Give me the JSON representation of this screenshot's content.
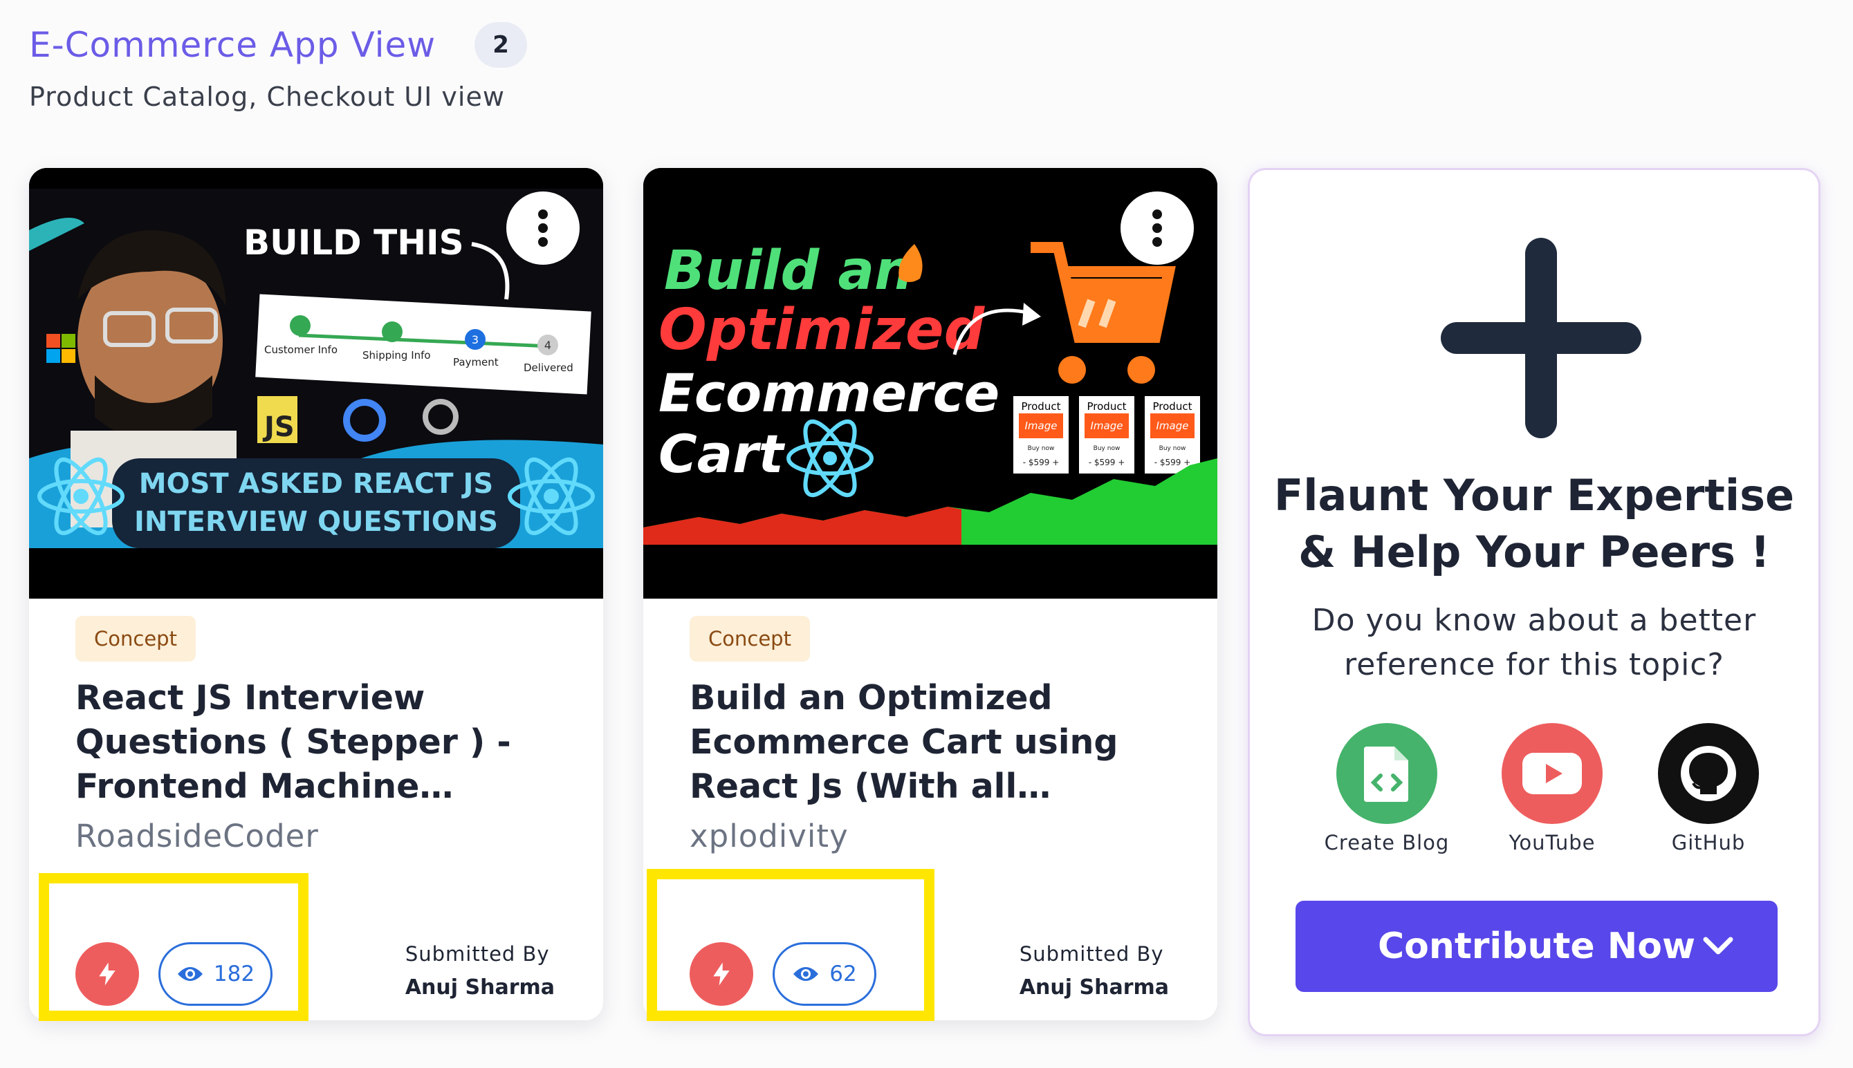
{
  "section": {
    "title": "E-Commerce App View",
    "count": "2",
    "subtitle": "Product Catalog, Checkout UI view"
  },
  "cards": [
    {
      "thumb": {
        "headline": "BUILD THIS",
        "steps": [
          "Customer Info",
          "Shipping Info",
          "Payment",
          "Delivered"
        ],
        "step_numbers": [
          "3",
          "4"
        ],
        "banner_line1": "MOST ASKED REACT JS",
        "banner_line2": "INTERVIEW QUESTIONS",
        "js_badge": "JS"
      },
      "tag": "Concept",
      "title": "React JS Interview Questions ( Stepper ) - Frontend Machine Coding...",
      "author": "RoadsideCoder",
      "views": "182",
      "submitted_label": "Submitted By",
      "submitted_name": "Anuj Sharma"
    },
    {
      "thumb": {
        "line1": "Build an",
        "line2": "Optimized",
        "line3": "Ecommerce",
        "line4": "Cart",
        "product_title": "Product",
        "product_image": "Image",
        "product_buy": "Buy now",
        "product_price": "- $599 +"
      },
      "tag": "Concept",
      "title": "Build an Optimized Ecommerce Cart using React Js (With all features...",
      "author": "xplodivity",
      "views": "62",
      "submitted_label": "Submitted By",
      "submitted_name": "Anuj Sharma"
    }
  ],
  "contribute": {
    "heading_line1": "Flaunt Your Expertise",
    "heading_line2": "& Help Your Peers !",
    "sub_line1": "Do you know about a better",
    "sub_line2": "reference for this topic?",
    "options": [
      {
        "label": "Create Blog",
        "icon": "blog-code-icon",
        "color": "#45b36b"
      },
      {
        "label": "YouTube",
        "icon": "youtube-icon",
        "color": "#ee5d5d"
      },
      {
        "label": "GitHub",
        "icon": "github-icon",
        "color": "#111111"
      }
    ],
    "cta_label": "Contribute Now"
  },
  "colors": {
    "accent": "#5847ea",
    "title": "#6b5ce7",
    "highlight": "#ffe600",
    "action_red": "#ee5d5d",
    "views_blue": "#2a6edb"
  }
}
